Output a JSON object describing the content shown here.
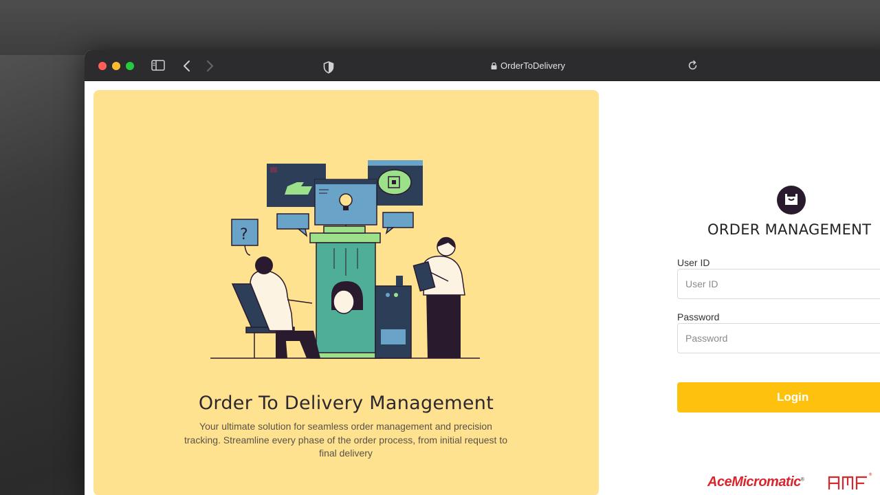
{
  "browser": {
    "address": "OrderToDelivery",
    "icons": {
      "sidebar": "sidebar-icon",
      "back": "chevron-left-icon",
      "forward": "chevron-right-icon",
      "privacy": "shield-icon",
      "lock": "lock-icon",
      "reload": "reload-icon"
    }
  },
  "hero": {
    "title": "Order To Delivery Management",
    "description": "Your ultimate solution for seamless order management and precision tracking. Streamline every phase of the order process, from initial request to final delivery"
  },
  "login": {
    "title": "ORDER MANAGEMENT",
    "user_id_label": "User ID",
    "user_id_placeholder": "User ID",
    "user_id_value": "",
    "password_label": "Password",
    "password_placeholder": "Password",
    "password_value": "",
    "submit_label": "Login"
  },
  "footer": {
    "brand_primary": "AceMicromatic",
    "brand_secondary_logo": "amf-logo"
  },
  "colors": {
    "hero_bg": "#ffe28f",
    "accent": "#fec10d",
    "logo_dark": "#2a1a2e",
    "brand_red": "#d8262c"
  }
}
